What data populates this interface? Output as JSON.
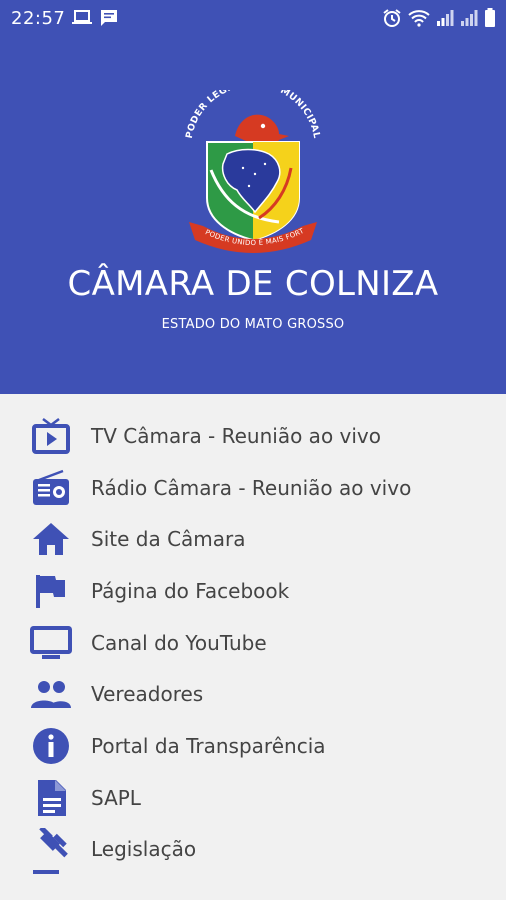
{
  "status_bar": {
    "time": "22:57",
    "left_icons": [
      "laptop-icon",
      "chat-icon"
    ],
    "right_icons": [
      "alarm-icon",
      "wifi-icon",
      "signal-icon",
      "signal-icon",
      "battery-icon"
    ]
  },
  "header": {
    "emblem": {
      "arc_text": "PODER LEGISLATIVO MUNICIPAL",
      "ribbon_text": "O PODER UNIDO É MAIS FORTE"
    },
    "title": "CÂMARA DE COLNIZA",
    "subtitle": "ESTADO DO MATO GROSSO"
  },
  "menu": [
    {
      "label": "TV Câmara - Reunião ao vivo",
      "icon": "tv-play-icon"
    },
    {
      "label": "Rádio Câmara - Reunião ao vivo",
      "icon": "radio-icon"
    },
    {
      "label": "Site da Câmara",
      "icon": "home-icon"
    },
    {
      "label": "Página do Facebook",
      "icon": "flag-icon"
    },
    {
      "label": "Canal do YouTube",
      "icon": "monitor-icon"
    },
    {
      "label": "Vereadores",
      "icon": "people-icon"
    },
    {
      "label": "Portal da Transparência",
      "icon": "info-icon"
    },
    {
      "label": "SAPL",
      "icon": "document-icon"
    },
    {
      "label": "Legislação",
      "icon": "gavel-icon"
    }
  ],
  "colors": {
    "header_bg": "#3f51b5",
    "icon": "#3f51b5",
    "list_bg": "#f1f1f1",
    "text": "#444444"
  }
}
